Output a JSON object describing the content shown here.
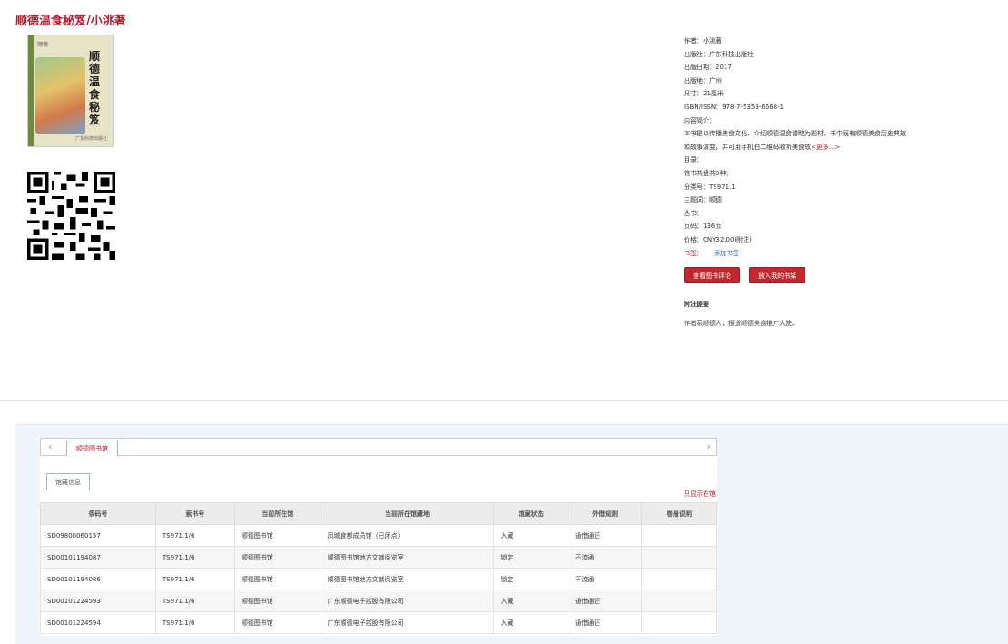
{
  "book": {
    "title": "顺德温食秘笈/小洮著",
    "cover": {
      "head": "顺德",
      "title": "顺德温食秘笈",
      "publisher": "广东科技出版社"
    }
  },
  "details": [
    {
      "label": "作者：",
      "value": "小洮著"
    },
    {
      "label": "出版社：",
      "value": "广东科技出版社"
    },
    {
      "label": "出版日期：",
      "value": "2017"
    },
    {
      "label": "出版地：",
      "value": "广州"
    },
    {
      "label": "尺寸：",
      "value": "21厘米"
    },
    {
      "label": "ISBN/ISSN：",
      "value": "978-7-5359-6668-1"
    },
    {
      "label": "内容简介：",
      "value": ""
    }
  ],
  "summary": {
    "line1": "本书是以传播美食文化、介绍顺德温食谱略为题材。书中既有顺德美食历史典故",
    "line2": "和故事演变，并可用手机扫二维码收听美食故",
    "more": "<更多...>"
  },
  "details2": [
    {
      "label": "目录：",
      "value": ""
    },
    {
      "label": "馆书共盘共0种：",
      "value": ""
    },
    {
      "label": "分类号：",
      "value": "TS971.1"
    },
    {
      "label": "主题词：",
      "value": "顺德"
    },
    {
      "label": "丛书：",
      "value": ""
    },
    {
      "label": "页码：",
      "value": "136页"
    },
    {
      "label": "价格：",
      "value": "CNY32.00(附注)"
    }
  ],
  "bookmark": {
    "label": "书签：",
    "link": "添加书签"
  },
  "buttons": {
    "review": "查看图书评论",
    "shelf": "放入我的书架"
  },
  "attachment": {
    "heading": "附注提要",
    "text": "作者系顺德人，报道顺德美食推广大使。"
  },
  "holdings": {
    "library_tab": "顺德图书馆",
    "subtab": "馆藏信息",
    "only_here": "只显示在馆",
    "headers": [
      "条码号",
      "索书号",
      "当前所在馆",
      "当前所在馆藏地",
      "馆藏状态",
      "外借规则",
      "卷册说明"
    ],
    "rows": [
      [
        "SD09800060157",
        "TS971.1/6",
        "顺德图书馆",
        "凤城食都成员馆（已闭点）",
        "入藏",
        "通借通还",
        ""
      ],
      [
        "SD00101194087",
        "TS971.1/6",
        "顺德图书馆",
        "顺德图书馆地方文献阅览室",
        "锁定",
        "不流通",
        ""
      ],
      [
        "SD00101194086",
        "TS971.1/6",
        "顺德图书馆",
        "顺德图书馆地方文献阅览室",
        "锁定",
        "不流通",
        ""
      ],
      [
        "SD00101224593",
        "TS971.1/6",
        "顺德图书馆",
        "广东顺德电子控股有限公司",
        "入藏",
        "通借通还",
        ""
      ],
      [
        "SD00101224594",
        "TS971.1/6",
        "顺德图书馆",
        "广东顺德电子控股有限公司",
        "入藏",
        "通借通还",
        ""
      ]
    ]
  },
  "icons": {
    "prev": "chevron-left-icon",
    "next": "chevron-right-icon"
  },
  "colors": {
    "accent": "#b01e2f",
    "button": "#c1272d",
    "link": "#2b62b4"
  }
}
